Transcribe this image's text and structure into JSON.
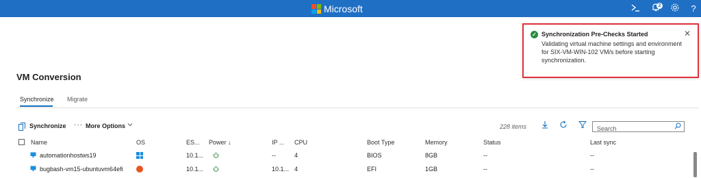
{
  "topbar": {
    "brand": "Microsoft",
    "notification_count": "2",
    "icons": [
      "cloud-shell-icon",
      "notifications-icon",
      "settings-icon",
      "help-icon"
    ]
  },
  "toast": {
    "title": "Synchronization Pre-Checks Started",
    "body": "Validating virtual machine settings and environment for SIX-VM-WIN-102 VM/s before starting synchronization.",
    "close_glyph": "✕"
  },
  "page": {
    "title": "VM Conversion"
  },
  "tabs": [
    {
      "label": "Synchronize",
      "selected": true
    },
    {
      "label": "Migrate",
      "selected": false
    }
  ],
  "toolbar": {
    "synchronize_label": "Synchronize",
    "more_options_label": "More Options",
    "item_count": "228 items",
    "search_placeholder": "Search"
  },
  "table": {
    "columns": [
      "Name",
      "OS",
      "ES...",
      "Power ↓",
      "IP ...",
      "CPU",
      "Boot Type",
      "Memory",
      "Status",
      "Last sync"
    ],
    "rows": [
      {
        "name": "automationhostws19",
        "os": "windows",
        "es": "10.1...",
        "ip": "--",
        "cpu": "4",
        "boot": "BIOS",
        "memory": "8GB",
        "status": "--",
        "last_sync": "--"
      },
      {
        "name": "bugbash-vm15-ubuntuvm64efi",
        "os": "ubuntu",
        "es": "10.1...",
        "ip": "10.1...",
        "cpu": "4",
        "boot": "EFI",
        "memory": "1GB",
        "status": "--",
        "last_sync": "--"
      }
    ]
  },
  "colors": {
    "topbar": "#1f6fc5",
    "accent": "#0f6cbd",
    "toast_border": "#e0303a",
    "success": "#2b8a3e"
  }
}
